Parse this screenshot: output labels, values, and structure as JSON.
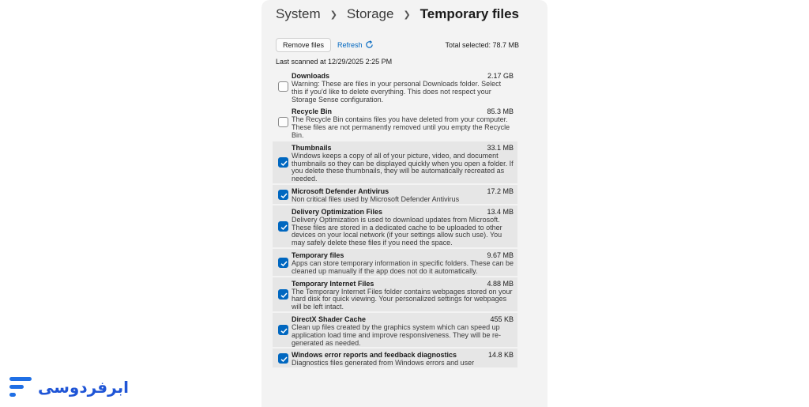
{
  "breadcrumb": {
    "items": [
      "System",
      "Storage"
    ],
    "current": "Temporary files"
  },
  "toolbar": {
    "remove_label": "Remove files",
    "refresh_label": "Refresh",
    "total_selected": "Total selected: 78.7 MB"
  },
  "last_scanned": "Last scanned at 12/29/2025 2:25 PM",
  "logo": {
    "text": "ابرفردوسی"
  },
  "colors": {
    "accent": "#0067c0",
    "logo": "#1f55d6"
  },
  "items": [
    {
      "name": "Downloads",
      "size": "2.17 GB",
      "checked": false,
      "desc": "Warning: These are files in your personal Downloads folder. Select this if you'd like to delete everything. This does not respect your Storage Sense configuration."
    },
    {
      "name": "Recycle Bin",
      "size": "85.3 MB",
      "checked": false,
      "desc": "The Recycle Bin contains files you have deleted from your computer. These files are not permanently removed until you empty the Recycle Bin."
    },
    {
      "name": "Thumbnails",
      "size": "33.1 MB",
      "checked": true,
      "desc": "Windows keeps a copy of all of your picture, video, and document thumbnails so they can be displayed quickly when you open a folder. If you delete these thumbnails, they will be automatically recreated as needed."
    },
    {
      "name": "Microsoft Defender Antivirus",
      "size": "17.2 MB",
      "checked": true,
      "desc": "Non critical files used by Microsoft Defender Antivirus"
    },
    {
      "name": "Delivery Optimization Files",
      "size": "13.4 MB",
      "checked": true,
      "desc": "Delivery Optimization is used to download updates from Microsoft. These files are stored in a dedicated cache to be uploaded to other devices on your local network (if your settings allow such use). You may safely delete these files if you need the space."
    },
    {
      "name": "Temporary files",
      "size": "9.67 MB",
      "checked": true,
      "desc": "Apps can store temporary information in specific folders. These can be cleaned up manually if the app does not do it automatically."
    },
    {
      "name": "Temporary Internet Files",
      "size": "4.88 MB",
      "checked": true,
      "desc": "The Temporary Internet Files folder contains webpages stored on your hard disk for quick viewing. Your personalized settings for webpages will be left intact."
    },
    {
      "name": "DirectX Shader Cache",
      "size": "455 KB",
      "checked": true,
      "desc": "Clean up files created by the graphics system which can speed up application load time and improve responsiveness. They will be re-generated as needed."
    },
    {
      "name": "Windows error reports and feedback diagnostics",
      "size": "14.8 KB",
      "checked": true,
      "desc": "Diagnostics files generated from Windows errors and user"
    }
  ]
}
